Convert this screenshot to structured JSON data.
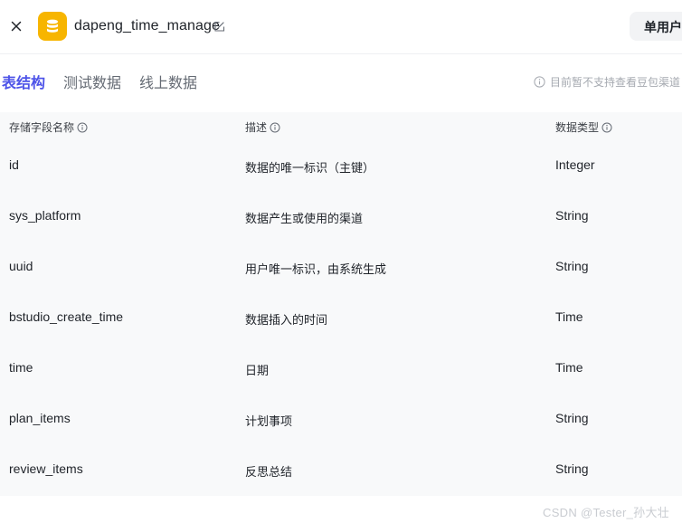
{
  "header": {
    "close_icon": "close-icon",
    "db_icon": "database-icon",
    "table_name": "dapeng_time_manage",
    "edit_icon": "edit-icon",
    "mode_button": "单用户"
  },
  "tabs": [
    {
      "label": "表结构",
      "active": true
    },
    {
      "label": "测试数据",
      "active": false
    },
    {
      "label": "线上数据",
      "active": false
    }
  ],
  "notice": {
    "icon": "info-icon",
    "text": "目前暂不支持查看豆包渠道"
  },
  "table": {
    "columns": [
      {
        "label": "存储字段名称",
        "icon": "info-icon"
      },
      {
        "label": "描述",
        "icon": "info-icon"
      },
      {
        "label": "数据类型",
        "icon": "info-icon"
      }
    ],
    "rows": [
      {
        "name": "id",
        "desc": "数据的唯一标识（主键）",
        "type": "Integer"
      },
      {
        "name": "sys_platform",
        "desc": "数据产生或使用的渠道",
        "type": "String"
      },
      {
        "name": "uuid",
        "desc": "用户唯一标识，由系统生成",
        "type": "String"
      },
      {
        "name": "bstudio_create_time",
        "desc": "数据插入的时间",
        "type": "Time"
      },
      {
        "name": "time",
        "desc": "日期",
        "type": "Time"
      },
      {
        "name": "plan_items",
        "desc": "计划事项",
        "type": "String"
      },
      {
        "name": "review_items",
        "desc": "反思总结",
        "type": "String"
      }
    ]
  },
  "watermark": "CSDN @Tester_孙大壮",
  "colors": {
    "accent": "#4d53e8",
    "db_icon_bg": "#f7b500",
    "row_bg": "#f8f9fa"
  }
}
